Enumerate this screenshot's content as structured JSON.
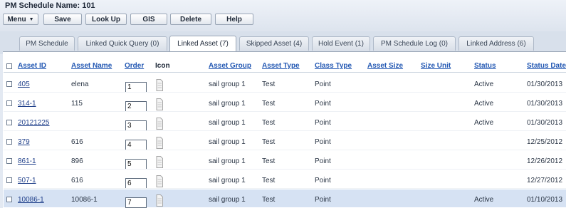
{
  "title": "PM Schedule Name: 101",
  "toolbar": {
    "menu": "Menu",
    "save": "Save",
    "lookup": "Look Up",
    "gis": "GIS",
    "delete": "Delete",
    "help": "Help"
  },
  "tabs": [
    "PM Schedule",
    "Linked Quick Query (0)",
    "Linked Asset (7)",
    "Skipped Asset (4)",
    "Hold Event (1)",
    "PM Schedule Log (0)",
    "Linked Address (6)"
  ],
  "active_tab": "Linked Asset (7)",
  "columns": {
    "asset_id": "Asset ID",
    "asset_name": "Asset Name",
    "order": "Order",
    "icon": "Icon",
    "asset_group": "Asset Group",
    "asset_type": "Asset Type",
    "class_type": "Class Type",
    "asset_size": "Asset Size",
    "size_unit": "Size Unit",
    "status": "Status",
    "status_date": "Status Date"
  },
  "rows": [
    {
      "asset_id": "405",
      "asset_name": "elena",
      "order": "1",
      "asset_group": "sail group 1",
      "asset_type": "Test",
      "class_type": "Point",
      "status": "Active",
      "status_date": "01/30/2013"
    },
    {
      "asset_id": "314-1",
      "asset_name": "115",
      "order": "2",
      "asset_group": "sail group 1",
      "asset_type": "Test",
      "class_type": "Point",
      "status": "Active",
      "status_date": "01/30/2013"
    },
    {
      "asset_id": "20121225",
      "asset_name": "",
      "order": "3",
      "asset_group": "sail group 1",
      "asset_type": "Test",
      "class_type": "Point",
      "status": "Active",
      "status_date": "01/30/2013"
    },
    {
      "asset_id": "379",
      "asset_name": "616",
      "order": "4",
      "asset_group": "sail group 1",
      "asset_type": "Test",
      "class_type": "Point",
      "status": "",
      "status_date": "12/25/2012"
    },
    {
      "asset_id": "861-1",
      "asset_name": "896",
      "order": "5",
      "asset_group": "sail group 1",
      "asset_type": "Test",
      "class_type": "Point",
      "status": "",
      "status_date": "12/26/2012"
    },
    {
      "asset_id": "507-1",
      "asset_name": "616",
      "order": "6",
      "asset_group": "sail group 1",
      "asset_type": "Test",
      "class_type": "Point",
      "status": "",
      "status_date": "12/27/2012"
    },
    {
      "asset_id": "10086-1",
      "asset_name": "10086-1",
      "order": "7",
      "asset_group": "sail group 1",
      "asset_type": "Test",
      "class_type": "Point",
      "status": "Active",
      "status_date": "01/10/2013"
    }
  ]
}
